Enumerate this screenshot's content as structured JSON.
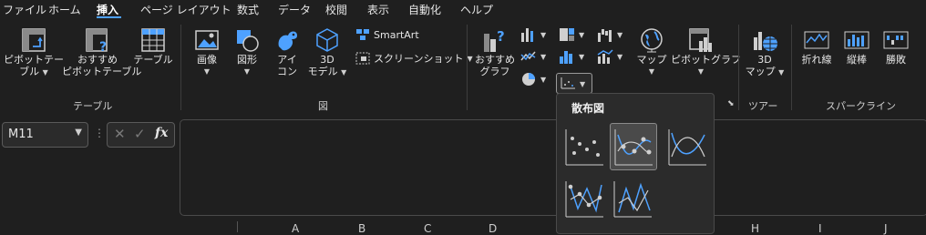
{
  "menu": {
    "items": [
      "ファイル",
      "ホーム",
      "挿入",
      "ページ レイアウト",
      "数式",
      "データ",
      "校閲",
      "表示",
      "自動化",
      "ヘルプ"
    ],
    "active": "挿入"
  },
  "ribbon": {
    "tables": {
      "pivot_table_line1": "ピボットテー",
      "pivot_table_line2": "ブル",
      "recommended_pivot_line1": "おすすめ",
      "recommended_pivot_line2": "ピボットテーブル",
      "table": "テーブル",
      "group_label": "テーブル"
    },
    "illustrations": {
      "image": "画像",
      "shapes": "図形",
      "icons_line1": "アイ",
      "icons_line2": "コン",
      "models_line1": "3D",
      "models_line2": "モデル",
      "smartart": "SmartArt",
      "screenshot": "スクリーンショット",
      "group_label": "図"
    },
    "charts": {
      "recommended_line1": "おすすめ",
      "recommended_line2": "グラフ",
      "maps": "マップ",
      "pivot_chart": "ピボットグラフ"
    },
    "tours": {
      "map3d_line1": "3D",
      "map3d_line2": "マップ",
      "group_label": "ツアー"
    },
    "sparklines": {
      "line": "折れ線",
      "column": "縦棒",
      "win_loss": "勝敗",
      "group_label": "スパークライン"
    }
  },
  "formula_bar": {
    "name_box": "M11",
    "fx": "fx"
  },
  "columns": [
    "A",
    "B",
    "C",
    "D",
    "H",
    "I",
    "J"
  ],
  "scatter_dropdown": {
    "title": "散布図",
    "items": [
      "scatter",
      "scatter-smooth-markers",
      "scatter-smooth-lines",
      "scatter-straight-markers",
      "scatter-straight-lines"
    ],
    "selected": "scatter-smooth-markers"
  },
  "colors": {
    "accent": "#4ea1ff",
    "background": "#1f1f1f",
    "dropdown_bg": "#2b2b2b"
  }
}
